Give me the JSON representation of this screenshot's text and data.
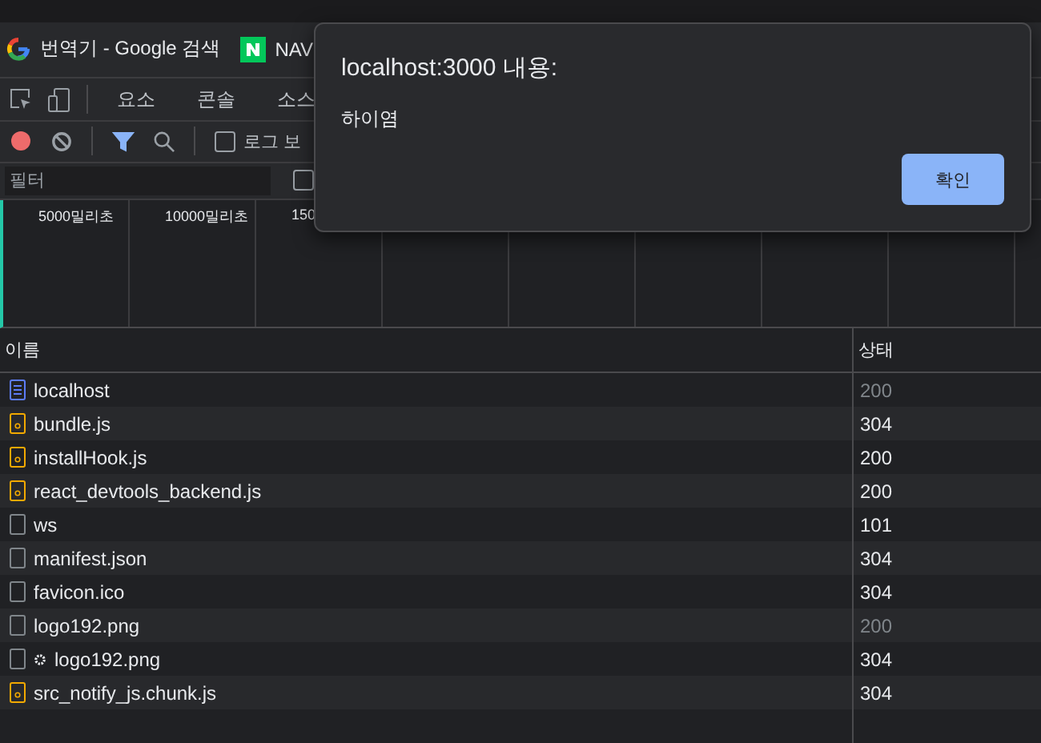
{
  "browser_tabs": [
    {
      "kind": "google",
      "title": "번역기 - Google 검색"
    },
    {
      "kind": "naver",
      "title": "NAV"
    }
  ],
  "devtools_tabs": [
    {
      "label": "요소",
      "selected": false
    },
    {
      "label": "콘솔",
      "selected": false
    },
    {
      "label": "소스",
      "selected": false
    }
  ],
  "network_toolbar": {
    "recording": true,
    "filter_active": true,
    "preserve_log": {
      "label": "로그 보",
      "checked": false
    }
  },
  "filter": {
    "placeholder": "필터",
    "checkbox_checked": false
  },
  "timeline": {
    "labels": [
      "5000밀리초",
      "10000밀리초",
      "150"
    ]
  },
  "table": {
    "columns": [
      "이름",
      "상태"
    ],
    "rows": [
      {
        "kind": "document",
        "name": "localhost",
        "status": "200",
        "dimmed": true,
        "service_worker": false
      },
      {
        "kind": "script",
        "name": "bundle.js",
        "status": "304",
        "dimmed": false,
        "service_worker": false
      },
      {
        "kind": "script",
        "name": "installHook.js",
        "status": "200",
        "dimmed": false,
        "service_worker": false
      },
      {
        "kind": "script",
        "name": "react_devtools_backend.js",
        "status": "200",
        "dimmed": false,
        "service_worker": false
      },
      {
        "kind": "other",
        "name": "ws",
        "status": "101",
        "dimmed": false,
        "service_worker": false
      },
      {
        "kind": "other",
        "name": "manifest.json",
        "status": "304",
        "dimmed": false,
        "service_worker": false
      },
      {
        "kind": "other",
        "name": "favicon.ico",
        "status": "304",
        "dimmed": false,
        "service_worker": false
      },
      {
        "kind": "other",
        "name": "logo192.png",
        "status": "200",
        "dimmed": true,
        "service_worker": false
      },
      {
        "kind": "other",
        "name": "logo192.png",
        "status": "304",
        "dimmed": false,
        "service_worker": true
      },
      {
        "kind": "script",
        "name": "src_notify_js.chunk.js",
        "status": "304",
        "dimmed": false,
        "service_worker": false
      }
    ]
  },
  "dialog": {
    "title": "localhost:3000 내용:",
    "message": "하이염",
    "button": "확인"
  }
}
